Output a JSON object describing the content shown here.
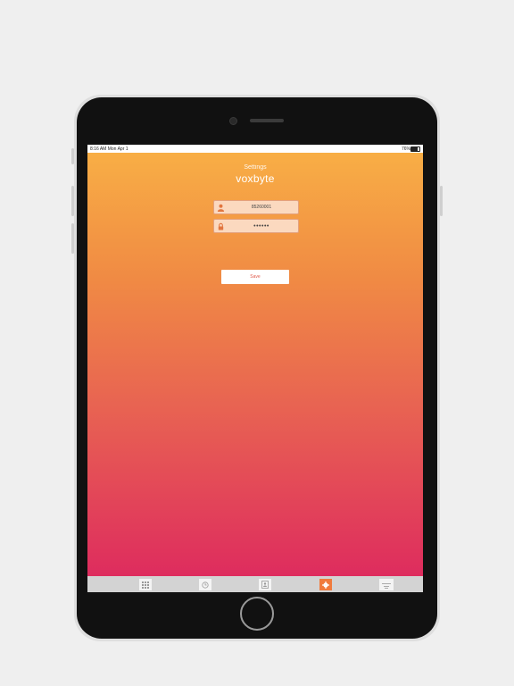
{
  "statusbar": {
    "time_date": "8:16 AM   Mon Apr 1",
    "battery_text": "76%",
    "battery_level": 0.76
  },
  "page": {
    "title": "Settings",
    "logo_text": "voxbyte"
  },
  "form": {
    "username_value": "85260001",
    "password_value": "••••••",
    "save_label": "Save"
  },
  "tabbar": {
    "tabs": [
      {
        "icon": "keypad-icon",
        "active": false
      },
      {
        "icon": "clock-icon",
        "active": false
      },
      {
        "icon": "contacts-icon",
        "active": false
      },
      {
        "icon": "gear-icon",
        "active": true
      },
      {
        "icon": "more-icon",
        "active": false
      }
    ],
    "active_color": "#f07b3d"
  },
  "colors": {
    "gradient_top": "#f8ae45",
    "gradient_bottom": "#de2c5e"
  }
}
